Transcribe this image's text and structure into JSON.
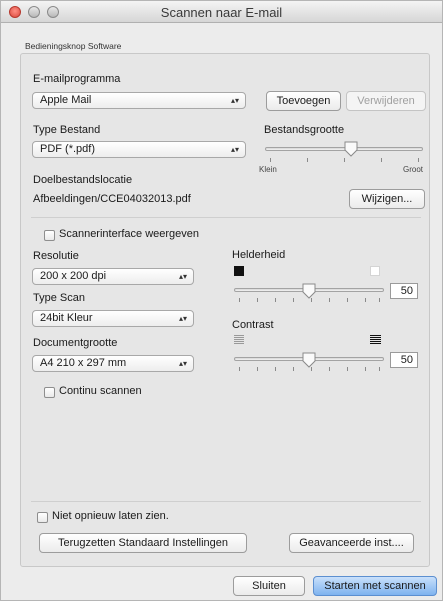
{
  "window": {
    "title": "Scannen naar E-mail"
  },
  "group": {
    "tab_label": "Bedieningsknop Software"
  },
  "email": {
    "label": "E-mailprogramma",
    "selected": "Apple Mail",
    "add_button": "Toevoegen",
    "remove_button": "Verwijderen"
  },
  "file_type": {
    "label": "Type Bestand",
    "selected": "PDF (*.pdf)"
  },
  "file_size": {
    "label": "Bestandsgrootte",
    "min_label": "Klein",
    "max_label": "Groot",
    "level": 0.55
  },
  "location": {
    "label": "Doelbestandslocatie",
    "value": "Afbeeldingen/CCE04032013.pdf",
    "change_button": "Wijzigen..."
  },
  "scanner_interface": {
    "label": "Scannerinterface weergeven",
    "checked": false
  },
  "resolution": {
    "label": "Resolutie",
    "selected": "200 x 200 dpi"
  },
  "scan_type": {
    "label": "Type Scan",
    "selected": "24bit Kleur"
  },
  "document_size": {
    "label": "Documentgrootte",
    "selected": "A4 210 x 297 mm"
  },
  "brightness": {
    "label": "Helderheid",
    "value": "50",
    "level": 0.5
  },
  "contrast": {
    "label": "Contrast",
    "value": "50",
    "level": 0.5
  },
  "continuous": {
    "label": "Continu scannen",
    "checked": false
  },
  "dont_show": {
    "label": "Niet opnieuw laten zien.",
    "checked": false
  },
  "buttons": {
    "reset": "Terugzetten Standaard Instellingen",
    "advanced": "Geavanceerde inst....",
    "close": "Sluiten",
    "start": "Starten met scannen"
  }
}
